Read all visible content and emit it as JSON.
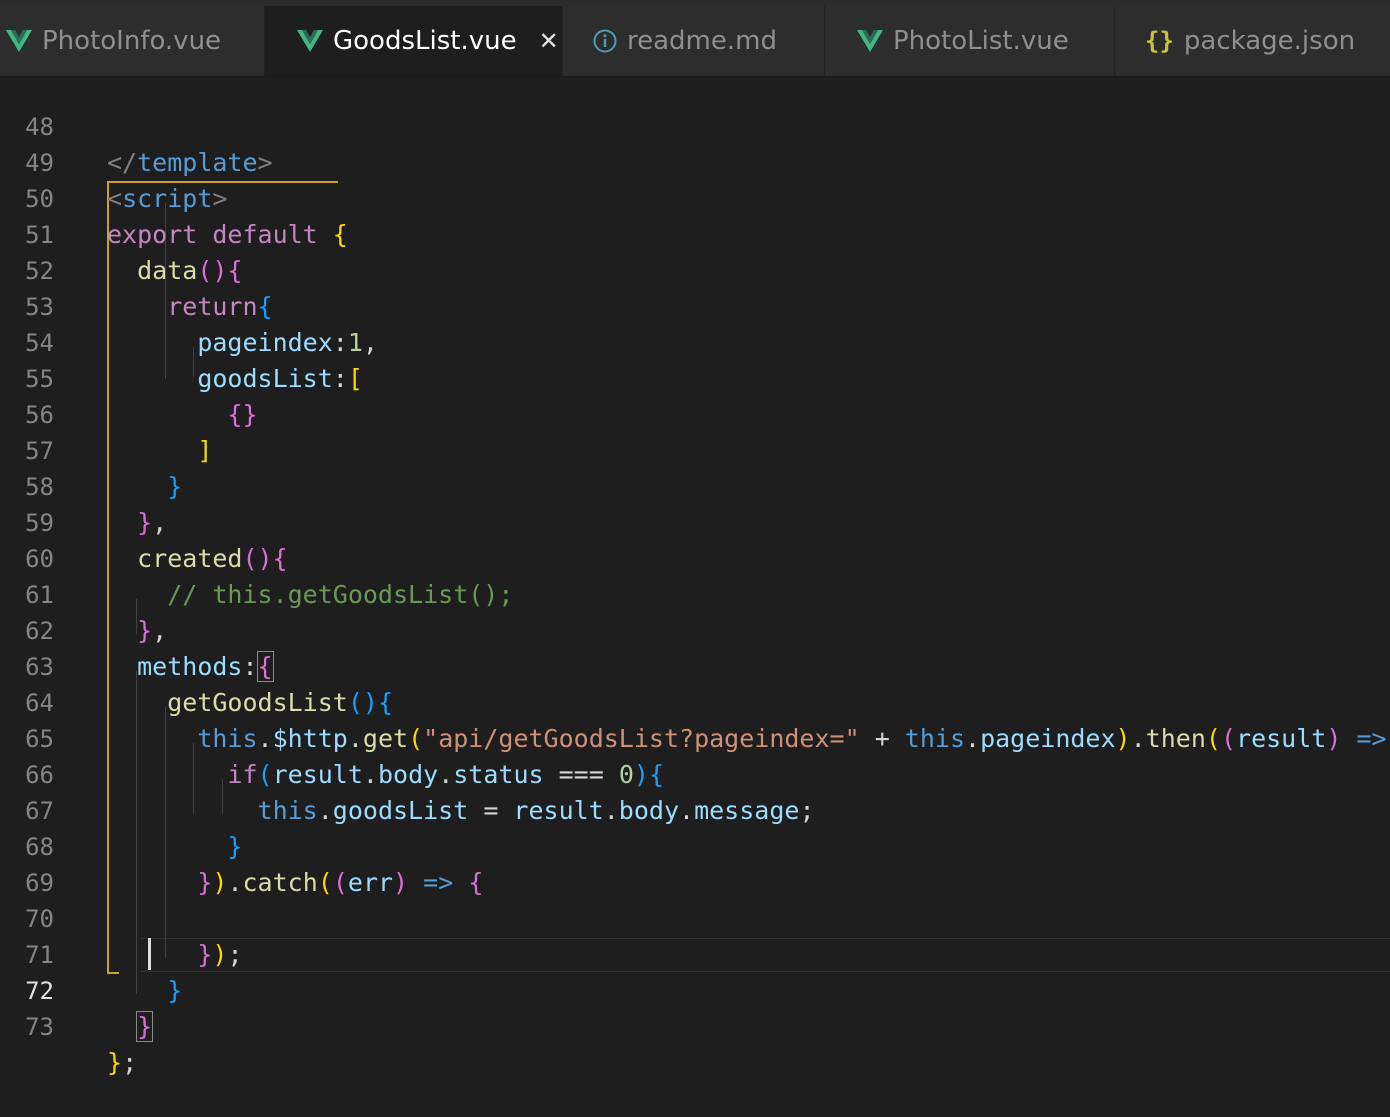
{
  "tabs": [
    {
      "label": "PhotoInfo.vue",
      "icon": "vue-icon",
      "active": false
    },
    {
      "label": "GoodsList.vue",
      "icon": "vue-icon",
      "active": true,
      "close": "✕"
    },
    {
      "label": "readme.md",
      "icon": "info-icon",
      "active": false
    },
    {
      "label": "PhotoList.vue",
      "icon": "vue-icon",
      "active": false
    },
    {
      "label": "package.json",
      "icon": "json-braces-icon",
      "active": false,
      "icon_glyph": "{}"
    }
  ],
  "editor": {
    "current_line": "72",
    "lines": [
      {
        "n": "48",
        "text": "</template>"
      },
      {
        "n": "49",
        "text": "<script>"
      },
      {
        "n": "50",
        "text": "export default {"
      },
      {
        "n": "51",
        "text": "  data(){"
      },
      {
        "n": "52",
        "text": "    return{"
      },
      {
        "n": "53",
        "text": "      pageindex:1,"
      },
      {
        "n": "54",
        "text": "      goodsList:["
      },
      {
        "n": "55",
        "text": "        {}"
      },
      {
        "n": "56",
        "text": "      ]"
      },
      {
        "n": "57",
        "text": "    }"
      },
      {
        "n": "58",
        "text": "  },"
      },
      {
        "n": "59",
        "text": "  created(){"
      },
      {
        "n": "60",
        "text": "    // this.getGoodsList();"
      },
      {
        "n": "61",
        "text": "  },"
      },
      {
        "n": "62",
        "text": "  methods:{"
      },
      {
        "n": "63",
        "text": "    getGoodsList(){"
      },
      {
        "n": "64",
        "text": "      this.$http.get(\"api/getGoodsList?pageindex=\" + this.pageindex).then((result) => {"
      },
      {
        "n": "65",
        "text": "        if(result.body.status === 0){"
      },
      {
        "n": "66",
        "text": "          this.goodsList = result.body.message;"
      },
      {
        "n": "67",
        "text": "        }"
      },
      {
        "n": "68",
        "text": "      }).catch((err) => {"
      },
      {
        "n": "69",
        "text": ""
      },
      {
        "n": "70",
        "text": "      });"
      },
      {
        "n": "71",
        "text": "    }"
      },
      {
        "n": "72",
        "text": "  }"
      },
      {
        "n": "73",
        "text": "};"
      }
    ]
  },
  "colors": {
    "background": "#1e1e1e",
    "keyword": "#c586c0",
    "tag": "#569cd6",
    "function": "#dcdcaa",
    "property": "#9cdcfe",
    "string": "#ce9178",
    "number": "#b5cea8",
    "comment": "#6a9955",
    "bracket_gold": "#ffd700",
    "bracket_orchid": "#da70d6",
    "bracket_blue": "#179fff",
    "scope_guide": "#c9a227",
    "vue_green": "#41b883"
  }
}
